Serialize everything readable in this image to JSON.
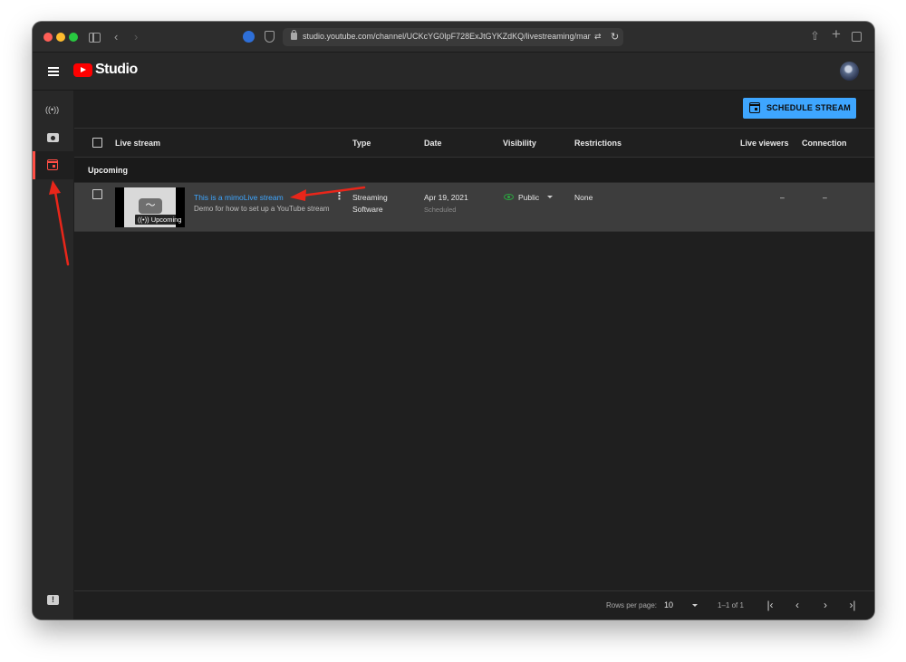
{
  "browser": {
    "url": "studio.youtube.com/channel/UCKcYG0IpF728ExJtGYKZdKQ/livestreaming/manag",
    "translate_glyph": "⇄",
    "reload_glyph": "↻",
    "back_glyph": "‹",
    "forward_glyph": "›",
    "share_glyph": "⇧",
    "plus_glyph": "+"
  },
  "header": {
    "app_title": "Studio"
  },
  "left_nav": {
    "items": [
      {
        "name": "stream",
        "glyph": "((•))"
      },
      {
        "name": "webcam"
      },
      {
        "name": "manage"
      }
    ],
    "feedback_glyph": "!"
  },
  "toolbar": {
    "schedule_button": "SCHEDULE STREAM"
  },
  "table": {
    "columns": [
      "Live stream",
      "Type",
      "Date",
      "Visibility",
      "Restrictions",
      "Live viewers",
      "Connection"
    ],
    "section_label": "Upcoming",
    "rows": [
      {
        "title": "This is a mimoLive stream",
        "description": "Demo for how to set up a YouTube stream",
        "thumb_glyph": "〜",
        "thumb_badge": "((•)) Upcoming",
        "type_line1": "Streaming",
        "type_line2": "Software",
        "date": "Apr 19, 2021",
        "date_status": "Scheduled",
        "visibility": "Public",
        "restrictions": "None",
        "live_viewers": "–",
        "connection": "–",
        "menu_glyph": "⋮"
      }
    ]
  },
  "footer": {
    "rows_per_page_label": "Rows per page:",
    "rows_per_page_value": "10",
    "range": "1–1 of 1",
    "first_glyph": "|‹",
    "prev_glyph": "‹",
    "next_glyph": "›",
    "last_glyph": "›|"
  },
  "colors": {
    "accent_blue": "#3ea6ff",
    "active_red": "#ff4e45",
    "annotation_red": "#e8261a",
    "public_green": "#2ba640"
  }
}
